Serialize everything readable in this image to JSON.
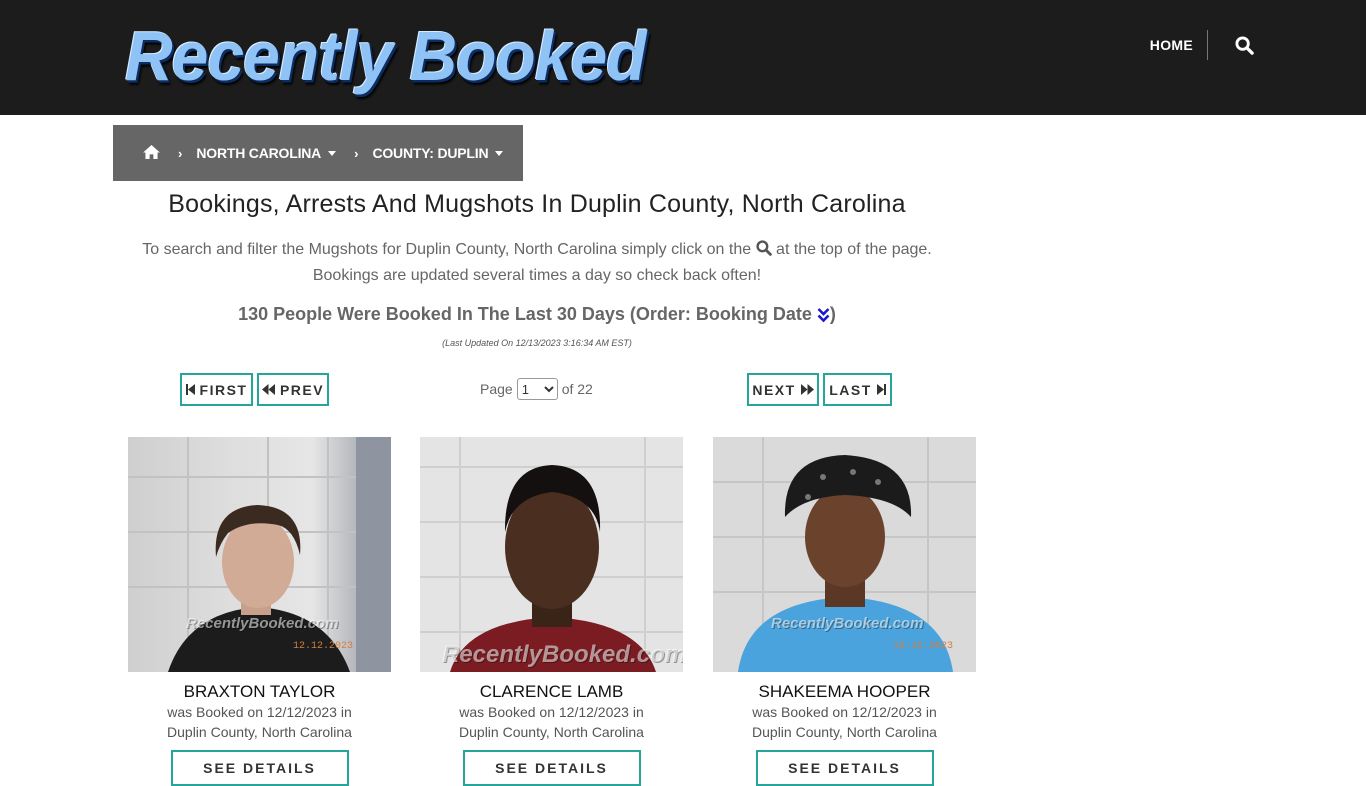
{
  "header": {
    "logo_text": "Recently Booked",
    "nav_home": "HOME"
  },
  "breadcrumb": {
    "state": "NORTH CAROLINA",
    "county": "COUNTY: DUPLIN"
  },
  "main": {
    "title": "Bookings, Arrests And Mugshots In Duplin County, North Carolina",
    "desc_before": "To search and filter the Mugshots for Duplin County, North Carolina simply click on the",
    "desc_after": "at the top of the page.",
    "desc_line2": "Bookings are updated several times a day so check back often!",
    "count_text": "130 People Were Booked In The Last 30 Days (Order: Booking Date",
    "count_close": ")",
    "updated": "(Last Updated On 12/13/2023 3:16:34 AM EST)"
  },
  "pager": {
    "first": "FIRST",
    "prev": "PREV",
    "next": "NEXT",
    "last": "LAST",
    "page_label": "Page",
    "current_page": "1",
    "of_label": "of 22"
  },
  "photo_watermark": "RecentlyBooked.com",
  "details_label": "SEE DETAILS",
  "bookings": [
    {
      "name": "BRAXTON TAYLOR",
      "booked": "was Booked on 12/12/2023 in",
      "location": "Duplin County, North Carolina",
      "stamp": "12.12.2023"
    },
    {
      "name": "CLARENCE LAMB",
      "booked": "was Booked on 12/12/2023 in",
      "location": "Duplin County, North Carolina",
      "stamp": ""
    },
    {
      "name": "SHAKEEMA HOOPER",
      "booked": "was Booked on 12/12/2023 in",
      "location": "Duplin County, North Carolina",
      "stamp": "12.12.2023"
    }
  ],
  "colors": {
    "topbar": "#1c1c1c",
    "breadcrumb": "#666666",
    "button_border": "#26a69a",
    "sort_icon": "#1a1acc"
  },
  "icons": {
    "home": "home-icon",
    "search": "search-icon",
    "sort": "double-chevron-down-icon"
  }
}
